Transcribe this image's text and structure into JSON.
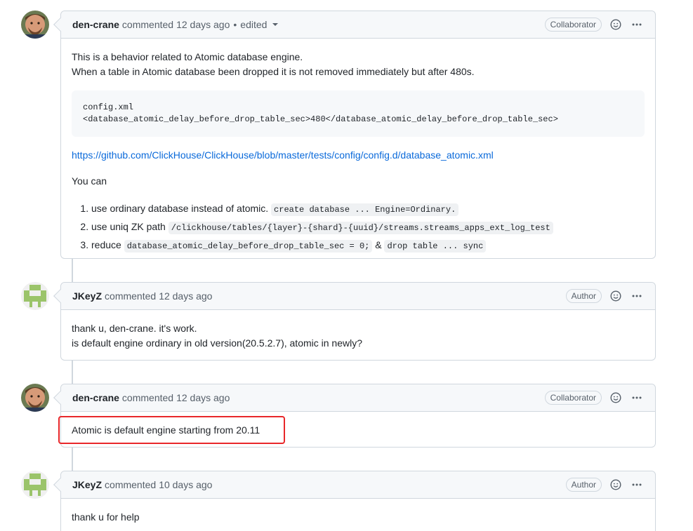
{
  "comments": [
    {
      "author": "den-crane",
      "action": "commented",
      "time": "12 days ago",
      "edited": "edited",
      "badge": "Collaborator",
      "para1": "This is a behavior related to Atomic database engine.",
      "para2": "When a table in Atomic database been dropped it is not removed immediately but after 480s.",
      "code": "config.xml\n<database_atomic_delay_before_drop_table_sec>480</database_atomic_delay_before_drop_table_sec>",
      "link": "https://github.com/ClickHouse/ClickHouse/blob/master/tests/config/config.d/database_atomic.xml",
      "you_can": "You can",
      "item1_text": "use ordinary database instead of atomic.",
      "item1_code": "create database ... Engine=Ordinary.",
      "item2_text": "use uniq ZK path",
      "item2_code": "/clickhouse/tables/{layer}-{shard}-{uuid}/streams.streams_apps_ext_log_test",
      "item3_text": "reduce",
      "item3_code1": "database_atomic_delay_before_drop_table_sec = 0;",
      "item3_amp": "&",
      "item3_code2": "drop table ... sync"
    },
    {
      "author": "JKeyZ",
      "action": "commented",
      "time": "12 days ago",
      "badge": "Author",
      "line1": "thank u, den-crane. it's work.",
      "line2": "is default engine ordinary in old version(20.5.2.7), atomic in newly?"
    },
    {
      "author": "den-crane",
      "action": "commented",
      "time": "12 days ago",
      "badge": "Collaborator",
      "line1": "Atomic is default engine starting from 20.11"
    },
    {
      "author": "JKeyZ",
      "action": "commented",
      "time": "10 days ago",
      "badge": "Author",
      "line1": "thank u for help"
    }
  ],
  "icons": {
    "emoji": "smiley-icon",
    "more": "kebab-horizontal-icon",
    "dropdown": "triangle-down-icon"
  },
  "colors": {
    "highlight": "#e8272a",
    "link": "#0969da",
    "border": "#d0d7de",
    "header_bg": "#f6f8fa"
  }
}
